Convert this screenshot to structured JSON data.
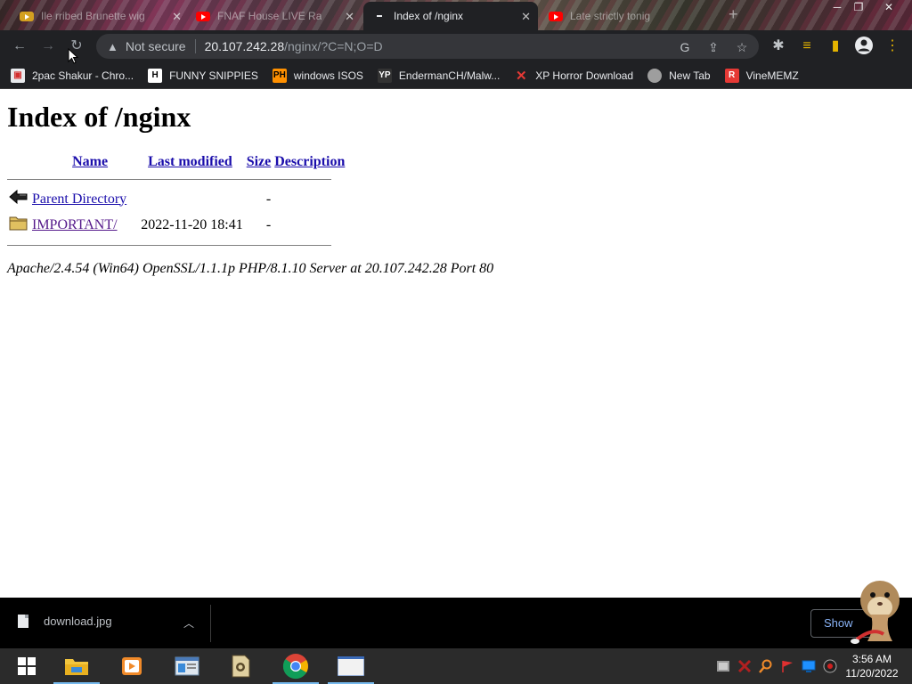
{
  "browser": {
    "tabs": [
      {
        "title": "Ile rribed Brunette wig",
        "icon": "youtube-icon",
        "active": false
      },
      {
        "title": "FNAF House LIVE Ra",
        "icon": "youtube-icon",
        "active": false
      },
      {
        "title": "Index of /nginx",
        "icon": "page-icon",
        "active": true
      },
      {
        "title": "Late strictly tonig",
        "icon": "youtube-icon",
        "active": false
      }
    ],
    "omnibox": {
      "security_label": "Not secure",
      "host": "20.107.242.28",
      "path": "/nginx/?C=N;O=D"
    },
    "bookmarks": [
      {
        "label": "2pac Shakur - Chro...",
        "icon": "chrome-store-icon",
        "color": "#e8eaed"
      },
      {
        "label": "FUNNY SNIPPIES",
        "icon": "h-icon",
        "color": "#ffffff"
      },
      {
        "label": "windows ISOS",
        "icon": "ph-icon",
        "color": "#ff9000"
      },
      {
        "label": "EndermanCH/Malw...",
        "icon": "yp-icon",
        "color": "#333333"
      },
      {
        "label": "XP Horror Download",
        "icon": "x-icon",
        "color": "#e53935"
      },
      {
        "label": "New Tab",
        "icon": "globe-icon",
        "color": "#9e9e9e"
      },
      {
        "label": "VineMEMZ",
        "icon": "r-icon",
        "color": "#e53935"
      }
    ]
  },
  "page": {
    "title": "Index of /nginx",
    "columns": {
      "name": "Name",
      "last_modified": "Last modified",
      "size": "Size",
      "description": "Description"
    },
    "rows": [
      {
        "icon": "back-arrow-icon",
        "name": "Parent Directory",
        "modified": "",
        "size": "-"
      },
      {
        "icon": "folder-icon",
        "name": "IMPORTANT/",
        "modified": "2022-11-20 18:41",
        "size": "-"
      }
    ],
    "address": "Apache/2.4.54 (Win64) OpenSSL/1.1.1p PHP/8.1.10 Server at 20.107.242.28 Port 80"
  },
  "downloads": {
    "file": "download.jpg",
    "show_all": "Show"
  },
  "taskbar": {
    "time": "3:56 AM",
    "date": "11/20/2022"
  }
}
